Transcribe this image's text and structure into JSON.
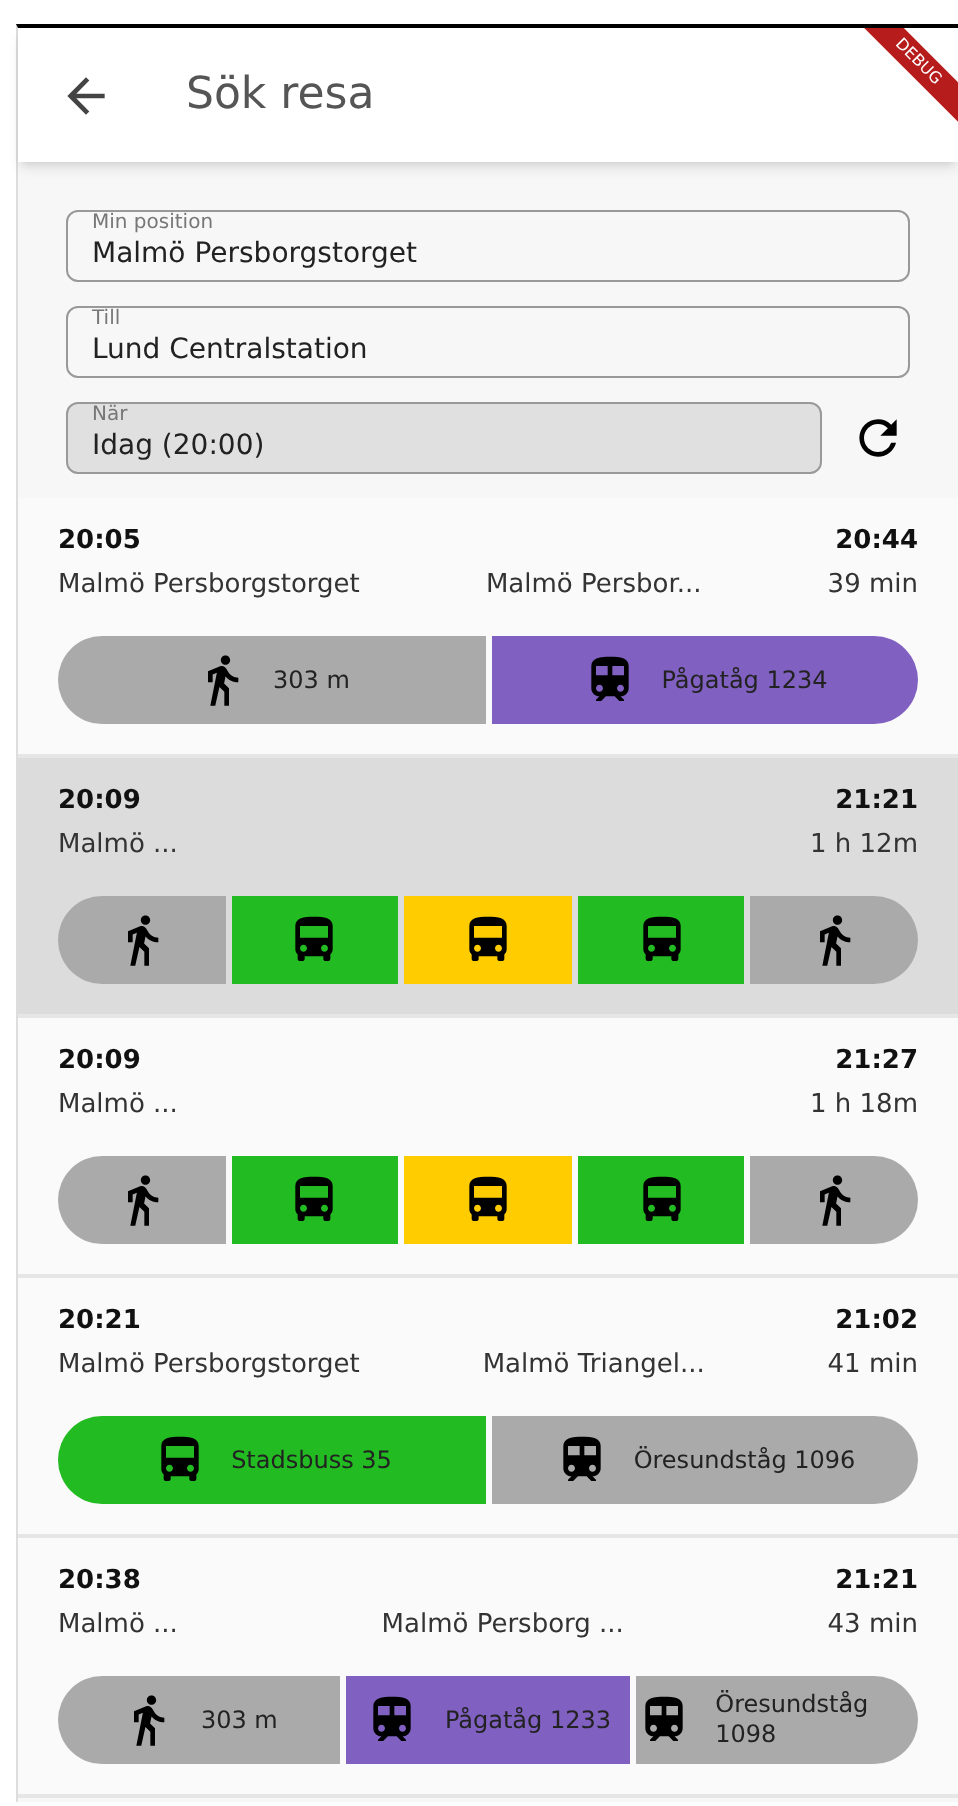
{
  "app_bar": {
    "title": "Sök resa",
    "banner": "DEBUG"
  },
  "fields": [
    {
      "label": "Min position",
      "value": "Malmö Persborgstorget",
      "disabled": false
    },
    {
      "label": "Till",
      "value": "Lund Centralstation",
      "disabled": false
    },
    {
      "label": "När",
      "value": "Idag (20:00)",
      "disabled": true
    }
  ],
  "journeys": [
    {
      "selected": false,
      "depart": "20:05",
      "arrive": "20:44",
      "origin": "Malmö Persborgstorget",
      "via": "Malmö Persbor...",
      "duration": "39 min",
      "legs": [
        {
          "kind": "walk",
          "color": "#aaaaaa",
          "label": "303 m"
        },
        {
          "kind": "train",
          "color": "#8060c0",
          "label": "Pågatåg 1234"
        }
      ]
    },
    {
      "selected": true,
      "depart": "20:09",
      "arrive": "21:21",
      "origin": "Malmö ...",
      "duration": "1 h 12m",
      "legs": [
        {
          "kind": "walk",
          "color": "#aaaaaa"
        },
        {
          "kind": "bus",
          "color": "#22bb22"
        },
        {
          "kind": "bus",
          "color": "#ffcc00"
        },
        {
          "kind": "bus",
          "color": "#22bb22"
        },
        {
          "kind": "walk",
          "color": "#aaaaaa"
        }
      ]
    },
    {
      "selected": false,
      "depart": "20:09",
      "arrive": "21:27",
      "origin": "Malmö ...",
      "duration": "1 h 18m",
      "legs": [
        {
          "kind": "walk",
          "color": "#aaaaaa"
        },
        {
          "kind": "bus",
          "color": "#22bb22"
        },
        {
          "kind": "bus",
          "color": "#ffcc00"
        },
        {
          "kind": "bus",
          "color": "#22bb22"
        },
        {
          "kind": "walk",
          "color": "#aaaaaa"
        }
      ]
    },
    {
      "selected": false,
      "depart": "20:21",
      "arrive": "21:02",
      "origin": "Malmö Persborgstorget",
      "via": "Malmö Triangel...",
      "duration": "41 min",
      "legs": [
        {
          "kind": "bus",
          "color": "#22bb22",
          "label": "Stadsbuss 35"
        },
        {
          "kind": "train",
          "color": "#aaaaaa",
          "label": "Öresundståg 1096"
        }
      ]
    },
    {
      "selected": false,
      "depart": "20:38",
      "arrive": "21:21",
      "origin": "Malmö ...",
      "via": "Malmö Persborg ...",
      "duration": "43 min",
      "legs": [
        {
          "kind": "walk",
          "color": "#aaaaaa",
          "label": "303 m"
        },
        {
          "kind": "train",
          "color": "#8060c0",
          "label": "Pågatåg 1233"
        },
        {
          "kind": "train",
          "color": "#aaaaaa",
          "label": "Öresundståg 1098"
        }
      ]
    }
  ]
}
